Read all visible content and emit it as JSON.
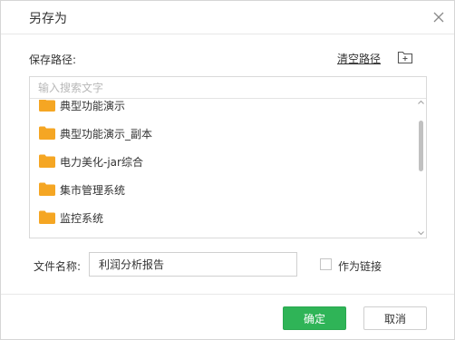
{
  "dialog": {
    "title": "另存为",
    "close_icon": "close-icon"
  },
  "path": {
    "label": "保存路径:",
    "clear_label": "清空路径",
    "new_folder_icon": "new-folder-icon"
  },
  "search": {
    "placeholder": "输入搜索文字",
    "value": ""
  },
  "folders": [
    {
      "label": "典型功能演示",
      "icon": "folder-icon"
    },
    {
      "label": "典型功能演示_副本",
      "icon": "folder-icon"
    },
    {
      "label": "电力美化-jar综合",
      "icon": "folder-icon"
    },
    {
      "label": "集市管理系统",
      "icon": "folder-icon"
    },
    {
      "label": "监控系统",
      "icon": "folder-icon"
    }
  ],
  "filename": {
    "label": "文件名称:",
    "value": "利润分析报告"
  },
  "link_option": {
    "label": "作为链接",
    "checked": false
  },
  "buttons": {
    "ok": "确定",
    "cancel": "取消"
  },
  "colors": {
    "primary": "#2fb457",
    "folder": "#f5a623",
    "border": "#d9d9d9"
  }
}
